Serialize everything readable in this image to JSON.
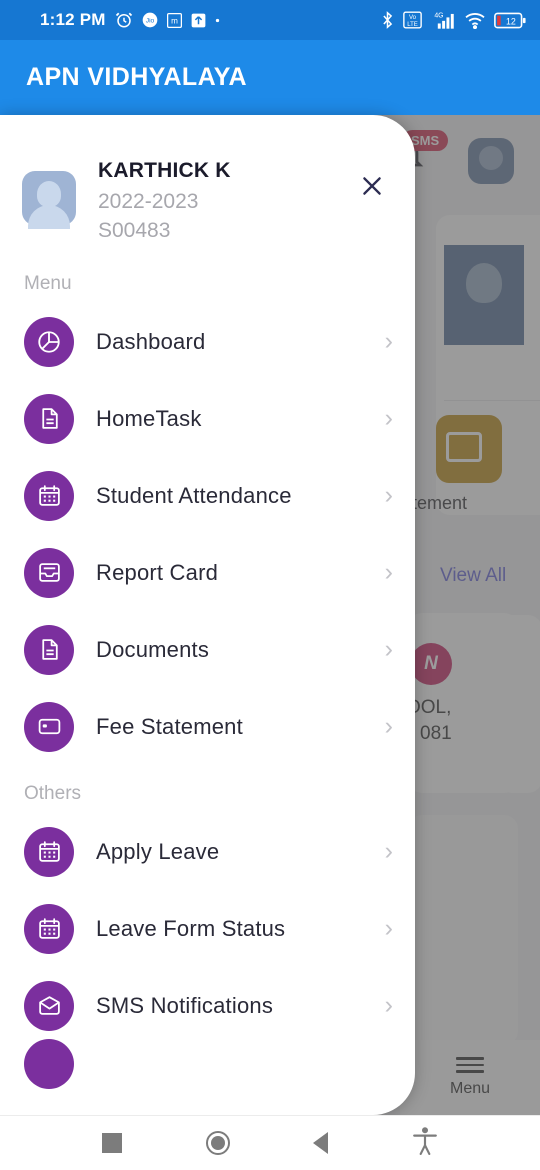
{
  "status_bar": {
    "time": "1:12 PM",
    "battery_level": "12",
    "network_type": "4G",
    "volte_label": "VoLTE",
    "icons": [
      "alarm-icon",
      "jio-icon",
      "m-app-icon",
      "upload-icon",
      "dot-icon",
      "bluetooth-icon",
      "volte-icon",
      "signal-icon",
      "wifi-icon",
      "battery-icon"
    ],
    "bar_color": "#1677d2"
  },
  "app_bar": {
    "title": "APN VIDHYALAYA",
    "color": "#1e8ae8"
  },
  "drawer": {
    "profile": {
      "name": "KARTHICK K",
      "academic_year": "2022-2023",
      "student_id": "S00483",
      "close_label": "×"
    },
    "sections": [
      {
        "label": "Menu",
        "items": [
          {
            "label": "Dashboard",
            "icon": "pie-chart-icon",
            "chevron": "›"
          },
          {
            "label": "HomeTask",
            "icon": "document-icon",
            "chevron": "›"
          },
          {
            "label": "Student Attendance",
            "icon": "calendar-icon",
            "chevron": "›"
          },
          {
            "label": "Report Card",
            "icon": "inbox-tray-icon",
            "chevron": "›"
          },
          {
            "label": "Documents",
            "icon": "document-icon",
            "chevron": "›"
          },
          {
            "label": "Fee Statement",
            "icon": "credit-card-icon",
            "chevron": "›"
          }
        ]
      },
      {
        "label": "Others",
        "items": [
          {
            "label": "Apply Leave",
            "icon": "calendar-icon",
            "chevron": "›"
          },
          {
            "label": "Leave Form Status",
            "icon": "calendar-icon",
            "chevron": "›"
          },
          {
            "label": "SMS Notifications",
            "icon": "envelope-icon",
            "chevron": "›"
          }
        ]
      }
    ],
    "accent_color": "#7b2f9e"
  },
  "background_app": {
    "sms_badge": "SMS",
    "fee_statement_text": "tement",
    "view_all": "View All",
    "card_avatar_letter": "N",
    "card_line1": "OOL,",
    "card_line2": "081",
    "bottom_nav_label": "Menu"
  },
  "android_nav": {
    "recents": "recents-square-icon",
    "home": "home-circle-icon",
    "back": "back-triangle-icon",
    "accessibility": "accessibility-icon"
  }
}
